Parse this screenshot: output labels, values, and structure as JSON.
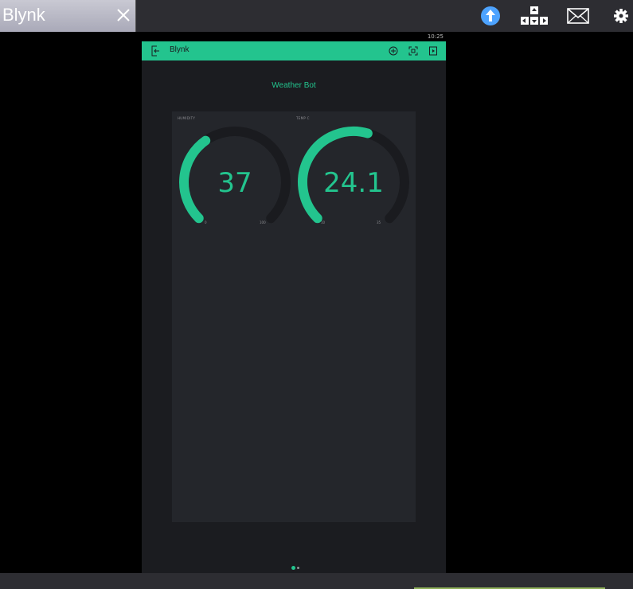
{
  "window": {
    "tab_title": "Blynk",
    "toolbar_icons": [
      "close-icon",
      "upload-icon",
      "dpad-icon",
      "mail-icon",
      "gear-icon"
    ],
    "accent_color": "#4da3ff"
  },
  "device": {
    "status_time": "10:25"
  },
  "app": {
    "title": "Blynk",
    "accent_color": "#23c48e",
    "icons": [
      "back-icon",
      "add-widget-icon",
      "qr-icon",
      "play-icon"
    ]
  },
  "project": {
    "name": "Weather Bot",
    "pages": 2,
    "current_page": 1
  },
  "gauges": [
    {
      "label": "HUMIDITY",
      "value": "37",
      "min": "0",
      "max": "100",
      "fill_fraction": 0.37
    },
    {
      "label": "TEMP C",
      "value": "24.1",
      "min": "10",
      "max": "35",
      "fill_fraction": 0.56
    }
  ]
}
